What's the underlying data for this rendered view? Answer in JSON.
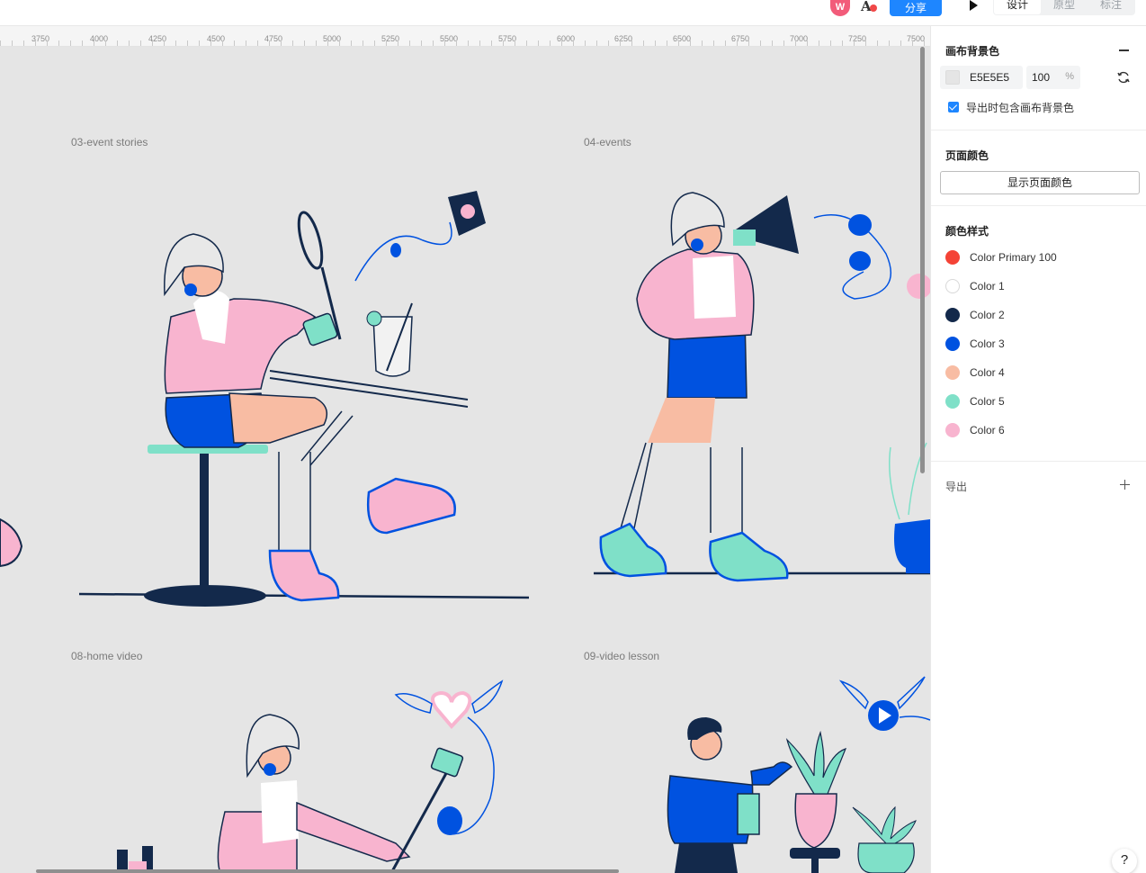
{
  "topbar": {
    "avatar_letter": "W",
    "share_label": "分享",
    "mode_tabs": [
      "设计",
      "原型",
      "标注"
    ],
    "font_icon_glyph": "A"
  },
  "ruler": {
    "ticks": [
      "3750",
      "4000",
      "4250",
      "4500",
      "4750",
      "5000",
      "5250",
      "5500",
      "5750",
      "6000",
      "6250",
      "6500",
      "6750",
      "7000",
      "7250",
      "7500"
    ]
  },
  "canvas": {
    "background": "#E5E5E5",
    "frames": [
      "03-event stories",
      "04-events",
      "08-home video",
      "09-video lesson"
    ]
  },
  "panel": {
    "canvas_bg": {
      "title": "画布背景色",
      "hex": "E5E5E5",
      "opacity": "100",
      "opacity_unit": "%",
      "include_on_export_label": "导出时包含画布背景色",
      "include_on_export": true
    },
    "page_color": {
      "title": "页面颜色",
      "show_button": "显示页面颜色"
    },
    "color_styles": {
      "title": "颜色样式",
      "items": [
        {
          "name": "Color Primary 100",
          "color": "#F44336"
        },
        {
          "name": "Color 1",
          "color": "#FFFFFF"
        },
        {
          "name": "Color 2",
          "color": "#13294B"
        },
        {
          "name": "Color 3",
          "color": "#0052E0"
        },
        {
          "name": "Color 4",
          "color": "#F8BCA3"
        },
        {
          "name": "Color 5",
          "color": "#7FE0C8"
        },
        {
          "name": "Color 6",
          "color": "#F8B4CF"
        }
      ]
    },
    "export": {
      "title": "导出"
    }
  },
  "help_label": "?"
}
